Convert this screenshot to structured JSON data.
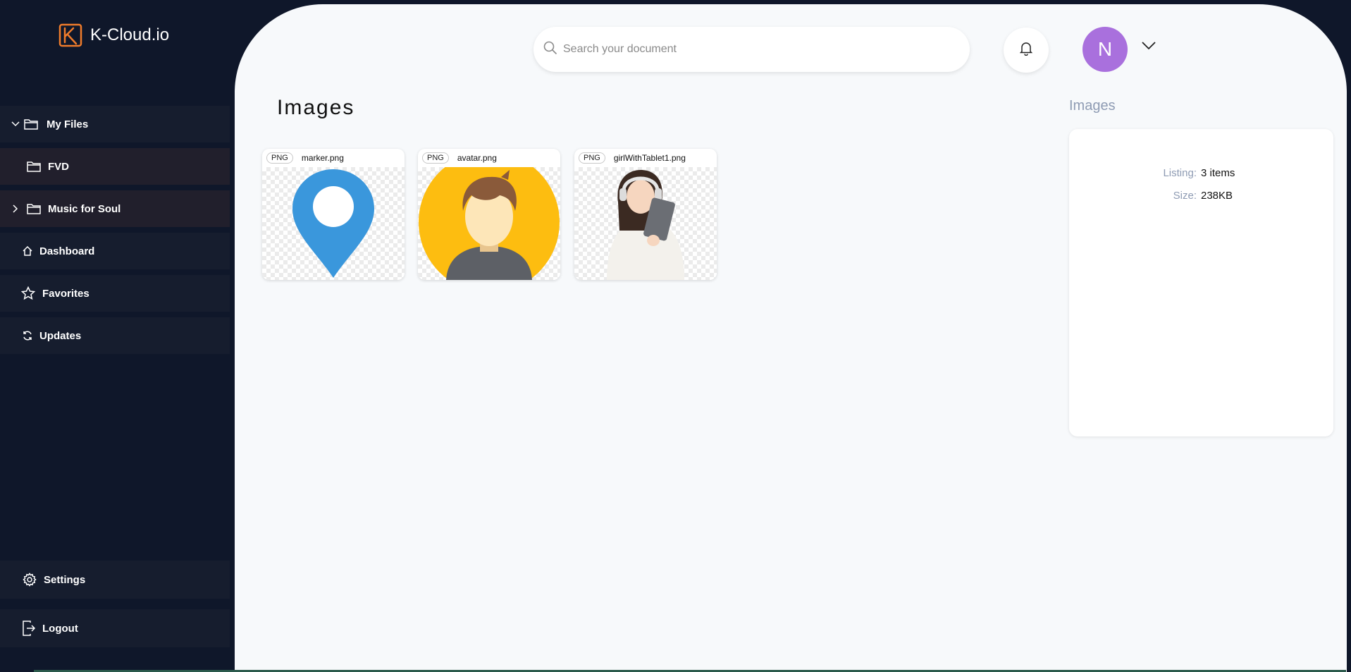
{
  "app": {
    "name": "K-Cloud.io",
    "accent": "#f07c2b"
  },
  "sidebar": {
    "items": [
      {
        "label": "My Files",
        "icon": "folder-icon",
        "chevron": "chevron-down-icon"
      },
      {
        "label": "FVD",
        "icon": "folder-icon"
      },
      {
        "label": "Music for Soul",
        "icon": "folder-icon",
        "chevron": "chevron-right-icon"
      },
      {
        "label": "Dashboard",
        "icon": "home-icon"
      },
      {
        "label": "Favorites",
        "icon": "star-icon"
      },
      {
        "label": "Updates",
        "icon": "refresh-icon"
      }
    ],
    "bottom": [
      {
        "label": "Settings",
        "icon": "gear-icon"
      },
      {
        "label": "Logout",
        "icon": "logout-icon"
      }
    ]
  },
  "header": {
    "search_placeholder": "Search your document",
    "avatar_initial": "N",
    "avatar_color": "#a970dd"
  },
  "main": {
    "title": "Images",
    "files": [
      {
        "type": "PNG",
        "name": "marker.png"
      },
      {
        "type": "PNG",
        "name": "avatar.png"
      },
      {
        "type": "PNG",
        "name": "girlWithTablet1.png"
      }
    ]
  },
  "details": {
    "title": "Images",
    "listing_label": "Listing:",
    "listing_value": "3 items",
    "size_label": "Size:",
    "size_value": "238KB"
  }
}
